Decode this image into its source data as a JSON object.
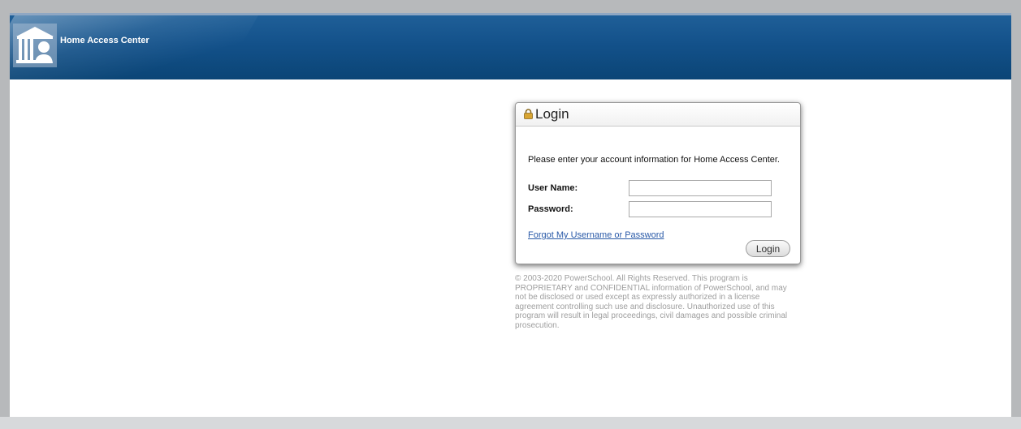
{
  "header": {
    "app_title": "Home Access Center",
    "logo_icon": "courthouse-person-logo-icon",
    "background": "#13518a"
  },
  "login": {
    "title": "Login",
    "lock_icon": "lock-icon",
    "instructions": "Please enter your account information for Home Access Center.",
    "username_label": "User Name:",
    "username_value": "",
    "password_label": "Password:",
    "password_value": "",
    "forgot_link": "Forgot My Username or Password",
    "submit_label": "Login"
  },
  "footer": {
    "copyright": "© 2003-2020 PowerSchool. All Rights Reserved. This program is PROPRIETARY and CONFIDENTIAL information of PowerSchool, and may not be disclosed or used except as expressly authorized in a license agreement controlling such use and disclosure. Unauthorized use of this program will result in legal proceedings, civil damages and possible criminal prosecution."
  },
  "colors": {
    "link": "#2a5aa8",
    "header_blue": "#13518a",
    "copyright_text": "#9e9e9e"
  }
}
